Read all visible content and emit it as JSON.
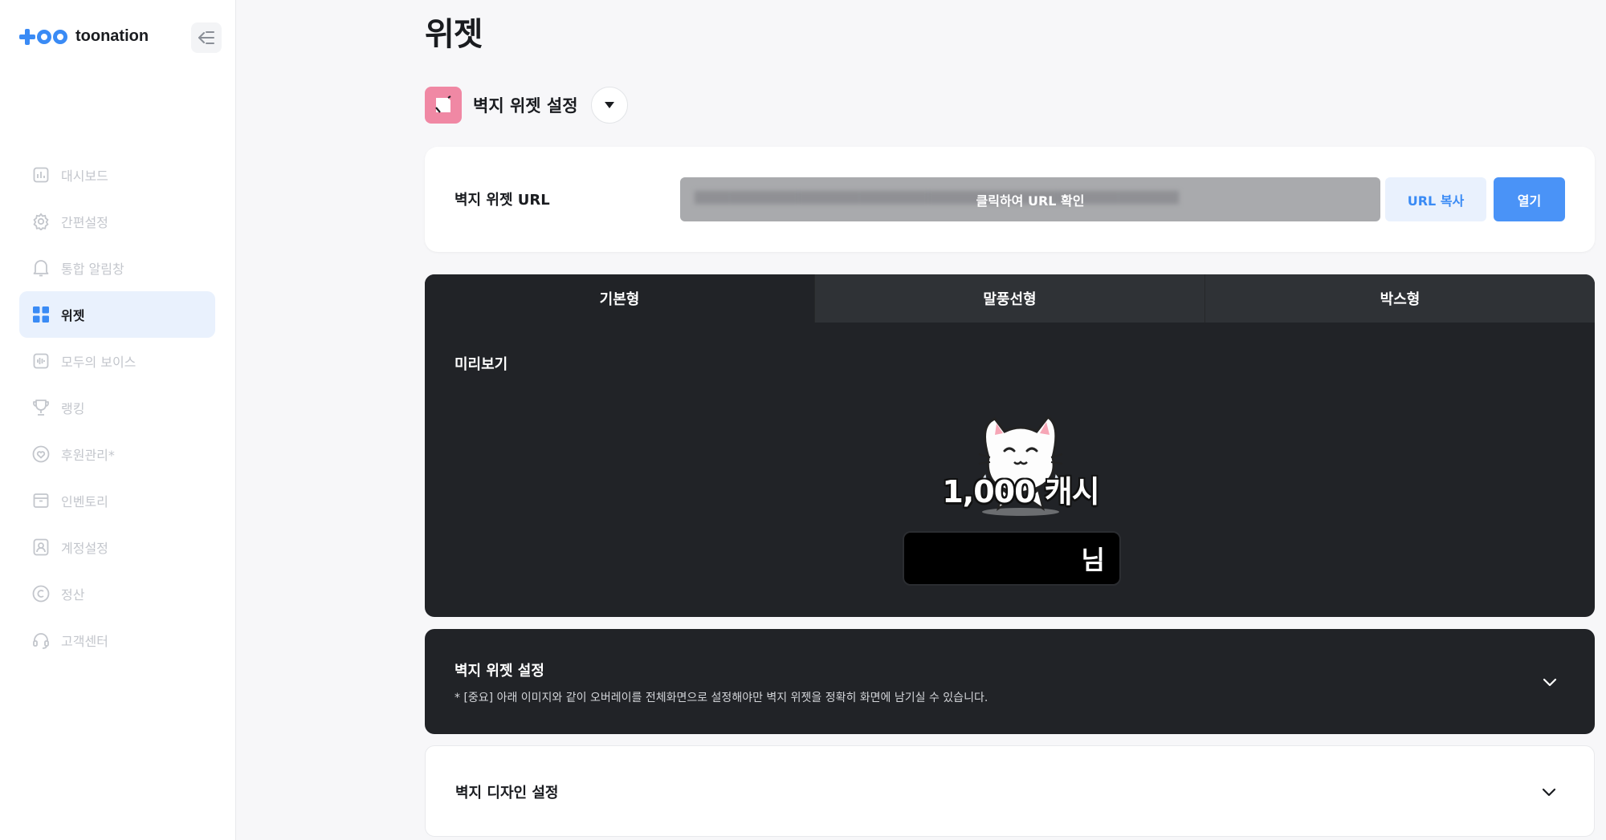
{
  "brand": {
    "name": "toonation",
    "accent": "#3a8bf5"
  },
  "sidebar": {
    "items": [
      {
        "label": "대시보드",
        "icon": "chart-icon",
        "active": false
      },
      {
        "label": "간편설정",
        "icon": "gear-icon",
        "active": false
      },
      {
        "label": "통합 알림창",
        "icon": "bell-icon",
        "active": false
      },
      {
        "label": "위젯",
        "icon": "grid-icon",
        "active": true
      },
      {
        "label": "모두의 보이스",
        "icon": "voice-icon",
        "active": false
      },
      {
        "label": "랭킹",
        "icon": "trophy-icon",
        "active": false
      },
      {
        "label": "후원관리*",
        "icon": "heart-icon",
        "active": false
      },
      {
        "label": "인벤토리",
        "icon": "inventory-icon",
        "active": false
      },
      {
        "label": "계정설정",
        "icon": "account-icon",
        "active": false
      },
      {
        "label": "정산",
        "icon": "copyright-icon",
        "active": false
      },
      {
        "label": "고객센터",
        "icon": "headset-icon",
        "active": false
      }
    ]
  },
  "page": {
    "title": "위젯"
  },
  "widget_selector": {
    "name": "벽지 위젯 설정"
  },
  "url_card": {
    "label": "벽지 위젯 URL",
    "field_hint": "클릭하여 URL 확인",
    "copy_label": "URL 복사",
    "open_label": "열기"
  },
  "tabs": [
    {
      "label": "기본형",
      "active": true
    },
    {
      "label": "말풍선형",
      "active": false
    },
    {
      "label": "박스형",
      "active": false
    }
  ],
  "preview": {
    "label": "미리보기",
    "amount": "1,000 캐시",
    "nickname_suffix": "님"
  },
  "sections": [
    {
      "title": "벽지 위젯 설정",
      "description": "* [중요] 아래 이미지와 같이 오버레이를 전체화면으로 설정해야만 벽지 위젯을 정확히 화면에 남기실 수 있습니다."
    },
    {
      "title": "벽지 디자인 설정"
    }
  ]
}
